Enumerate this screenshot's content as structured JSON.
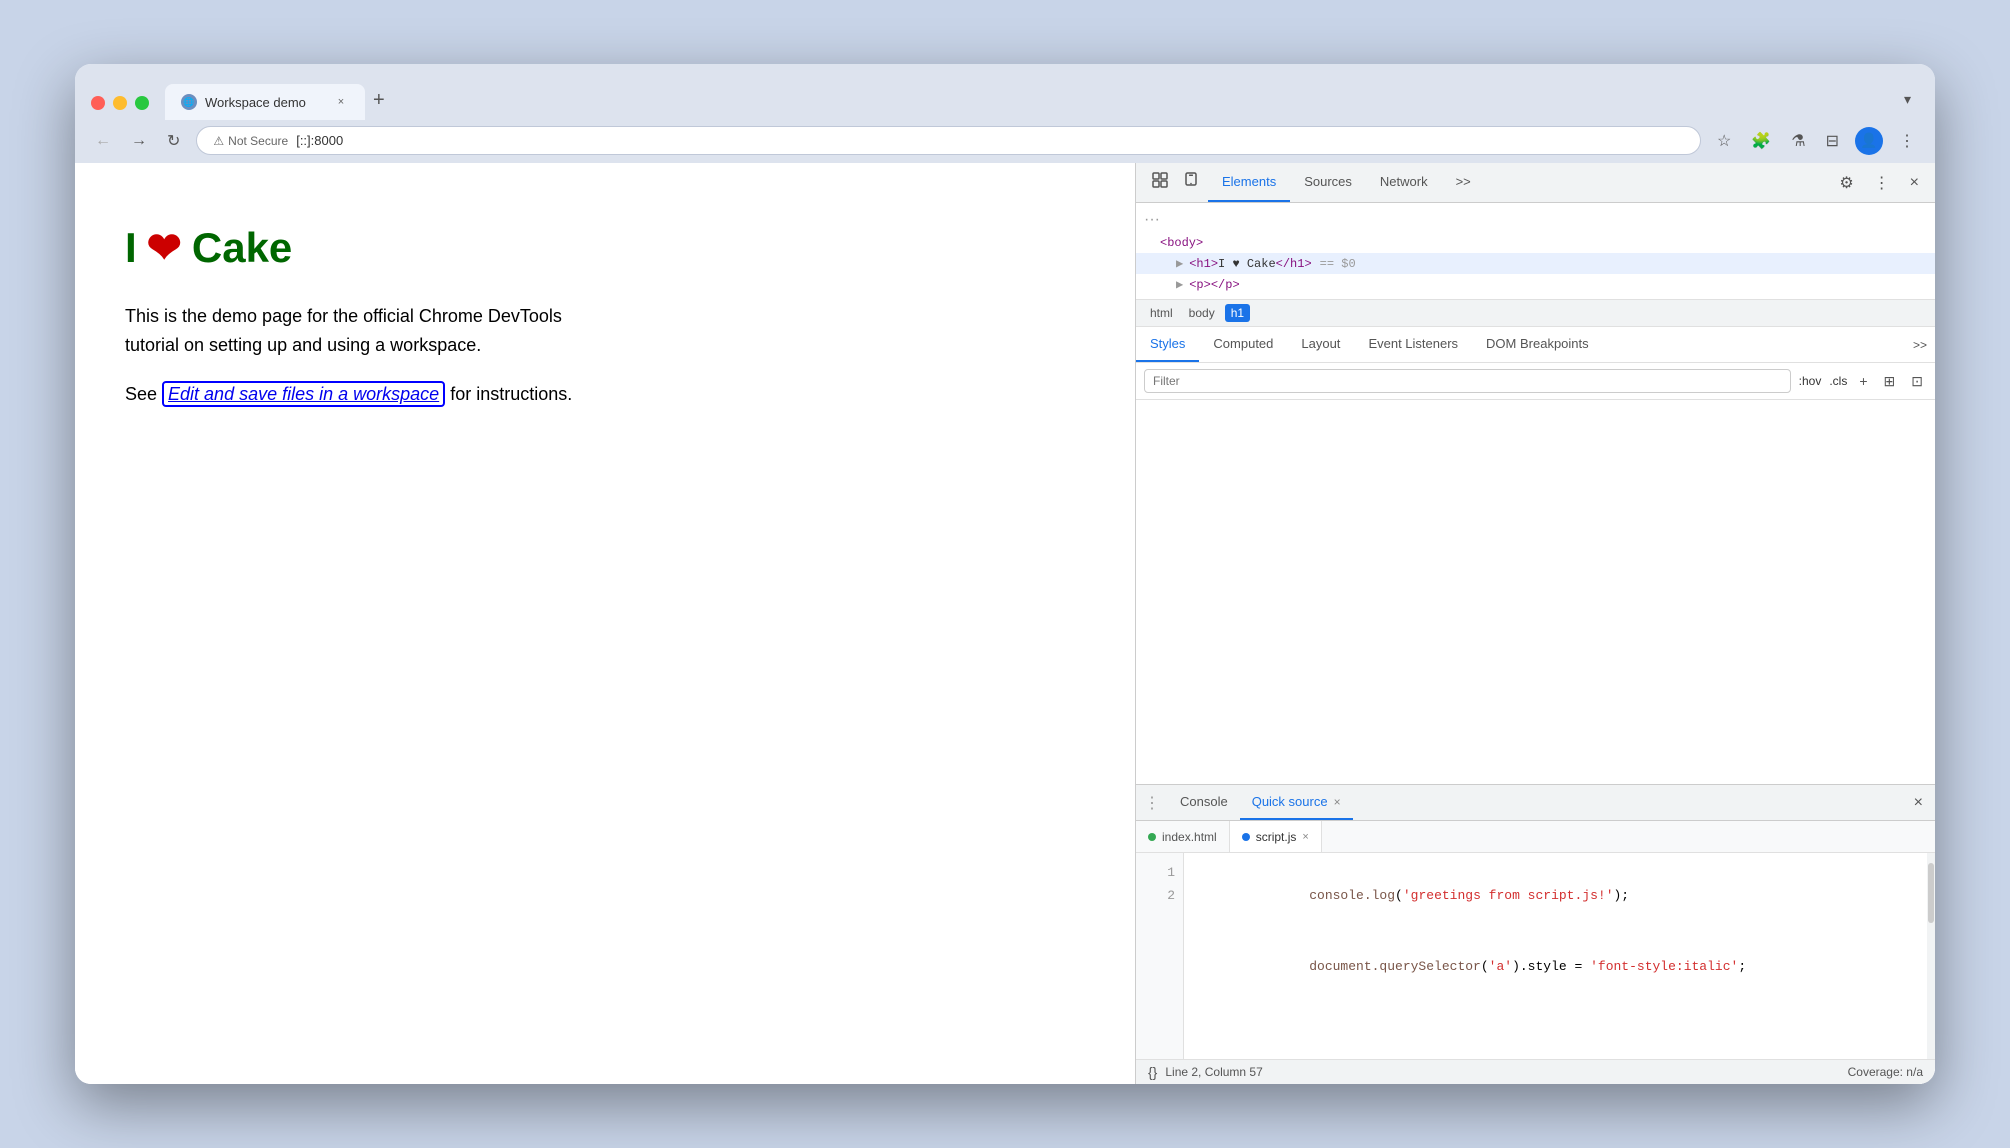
{
  "browser": {
    "tab": {
      "title": "Workspace demo",
      "close_label": "×",
      "new_tab_label": "+"
    },
    "chevron_label": "▾",
    "nav": {
      "back": "←",
      "forward": "→",
      "reload": "↻"
    },
    "addressbar": {
      "not_secure": "Not Secure",
      "url": "[::]:8000"
    }
  },
  "webpage": {
    "heading_text": "Cake",
    "description": "This is the demo page for the official Chrome DevTools tutorial on setting up and using a workspace.",
    "link_prefix": "See ",
    "link_text": "Edit and save files in a workspace",
    "link_suffix": " for instructions."
  },
  "devtools": {
    "tabs": [
      {
        "label": "Elements",
        "active": true
      },
      {
        "label": "Sources",
        "active": false
      },
      {
        "label": "Network",
        "active": false
      }
    ],
    "more_tabs": ">>",
    "elements_panel": {
      "dots": "···",
      "row1": "<body>",
      "row2_open": "<h1>I ♥ Cake</h1>",
      "row2_marker": "== $0",
      "row3": "<p> </p>",
      "expand_arrow": "▶"
    },
    "breadcrumbs": [
      {
        "label": "html",
        "active": false
      },
      {
        "label": "body",
        "active": false
      },
      {
        "label": "h1",
        "active": true
      }
    ],
    "styles_tabs": [
      {
        "label": "Styles",
        "active": true
      },
      {
        "label": "Computed",
        "active": false
      },
      {
        "label": "Layout",
        "active": false
      },
      {
        "label": "Event Listeners",
        "active": false
      },
      {
        "label": "DOM Breakpoints",
        "active": false
      }
    ],
    "styles_more": ">>",
    "filter_placeholder": "Filter",
    "filter_controls": {
      "hov": ":hov",
      "cls": ".cls",
      "plus": "+",
      "icon1": "⊞",
      "icon2": "⊡"
    },
    "bottom_panel": {
      "dots": "⋮",
      "tabs": [
        {
          "label": "Console",
          "active": false,
          "closable": false
        },
        {
          "label": "Quick source",
          "active": true,
          "closable": true
        }
      ],
      "close_btn": "×"
    },
    "file_tabs": [
      {
        "label": "index.html",
        "dot": "green",
        "active": false
      },
      {
        "label": "script.js",
        "dot": "blue",
        "active": true,
        "closable": true
      }
    ],
    "code": {
      "lines": [
        {
          "num": "1",
          "text": "console.log('greetings from script.js!');"
        },
        {
          "num": "2",
          "text": "document.querySelector('a').style = 'font-style:italic';"
        }
      ]
    },
    "status": {
      "line_col": "Line 2, Column 57",
      "coverage": "Coverage: n/a"
    },
    "toolbar_icons": {
      "settings": "⚙",
      "more": "⋮",
      "close": "×",
      "inspect": "⊡",
      "device": "⊟"
    }
  }
}
